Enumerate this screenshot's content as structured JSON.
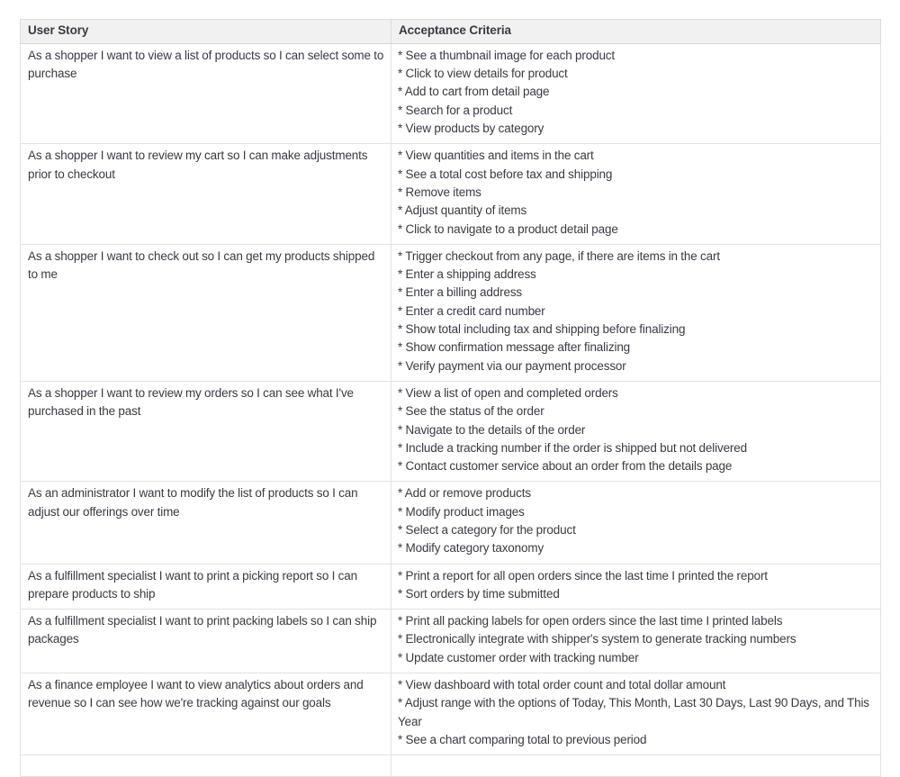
{
  "table": {
    "columns": [
      {
        "key": "user_story",
        "label": "User Story"
      },
      {
        "key": "acceptance_criteria",
        "label": "Acceptance Criteria"
      }
    ],
    "bullet_marker": "*",
    "colors": {
      "header_background": "#f1f1f1",
      "border": "#e2e2e2",
      "outer_border": "#dcdcdc",
      "text": "#3a3a44",
      "page_background": "#ffffff"
    },
    "rows": [
      {
        "user_story": "As a shopper I want to view a list of products so I can select some to purchase",
        "acceptance_criteria": [
          "* See a thumbnail image for each product",
          "* Click to view details for product",
          "* Add to cart from detail page",
          "* Search for a product",
          "* View products by category"
        ]
      },
      {
        "user_story": "As a shopper I want to review my cart so I can make adjustments prior to checkout",
        "acceptance_criteria": [
          "* View quantities and items in the cart",
          "* See a total cost before tax and shipping",
          "* Remove items",
          "* Adjust quantity of items",
          "* Click to navigate to a product detail page"
        ]
      },
      {
        "user_story": "As a shopper I want to check out so I can get my products shipped to me",
        "acceptance_criteria": [
          "* Trigger checkout from any page, if there are items in the cart",
          "* Enter a shipping address",
          "* Enter a billing address",
          "* Enter a credit card number",
          "* Show total including tax and shipping before finalizing",
          "* Show confirmation message after finalizing",
          "* Verify payment via our payment processor"
        ]
      },
      {
        "user_story": "As a shopper I want to review my orders so I can see what I've purchased in the past",
        "acceptance_criteria": [
          "* View a list of open and completed orders",
          "* See the status of the order",
          "* Navigate to the details of the order",
          "* Include a tracking number if the order is shipped but not delivered",
          "* Contact customer service about an order from the details page"
        ]
      },
      {
        "user_story": "As an administrator I want to modify the list of products so I can adjust our offerings over time",
        "acceptance_criteria": [
          "* Add or remove products",
          "* Modify product images",
          "* Select a category for the product",
          "* Modify category taxonomy"
        ]
      },
      {
        "user_story": "As a fulfillment specialist I want to print a picking report so I can prepare products to ship",
        "acceptance_criteria": [
          "* Print a report for all open orders since the last time I printed the report",
          "* Sort orders by time submitted"
        ]
      },
      {
        "user_story": "As a fulfillment specialist I want to print packing labels so I can ship packages",
        "acceptance_criteria": [
          "* Print all packing labels for open orders since the last time I printed labels",
          "* Electronically integrate with shipper's system to generate tracking numbers",
          "* Update customer order with tracking number"
        ]
      },
      {
        "user_story": "As a finance employee I want to view analytics about orders and revenue so I can see how we're tracking against our goals",
        "acceptance_criteria": [
          "* View dashboard with total order count and total dollar amount",
          "* Adjust range with the options of Today, This Month, Last 30 Days, Last 90 Days, and This Year",
          "* See a chart comparing total to previous period"
        ]
      }
    ]
  }
}
